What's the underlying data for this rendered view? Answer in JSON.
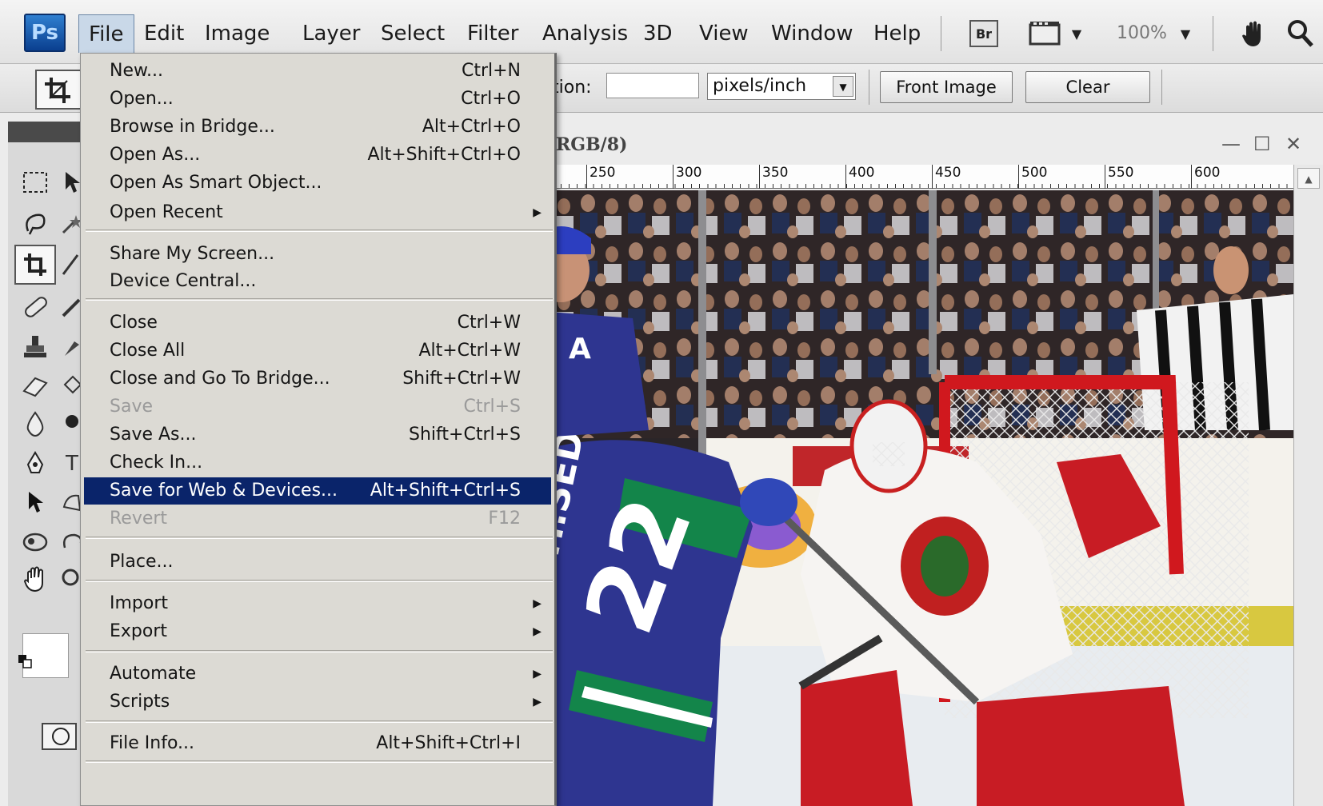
{
  "app": {
    "logo": "Ps"
  },
  "menubar": {
    "items": [
      "File",
      "Edit",
      "Image",
      "Layer",
      "Select",
      "Filter",
      "Analysis",
      "3D",
      "View",
      "Window",
      "Help"
    ],
    "bridge_label": "Br",
    "zoom": "100%"
  },
  "options": {
    "resolution_label": "tion:",
    "resolution_value": "",
    "units": "pixels/inch",
    "front_image": "Front Image",
    "clear": "Clear"
  },
  "document": {
    "title": "RGB/8)",
    "ruler": [
      "250",
      "300",
      "350",
      "400",
      "450",
      "500",
      "550",
      "600"
    ]
  },
  "file_menu": {
    "items": [
      {
        "label": "New...",
        "shortcut": "Ctrl+N"
      },
      {
        "label": "Open...",
        "shortcut": "Ctrl+O"
      },
      {
        "label": "Browse in Bridge...",
        "shortcut": "Alt+Ctrl+O"
      },
      {
        "label": "Open As...",
        "shortcut": "Alt+Shift+Ctrl+O"
      },
      {
        "label": "Open As Smart Object...",
        "shortcut": ""
      },
      {
        "label": "Open Recent",
        "shortcut": ""
      },
      {
        "label": "Share My Screen...",
        "shortcut": ""
      },
      {
        "label": "Device Central...",
        "shortcut": ""
      },
      {
        "label": "Close",
        "shortcut": "Ctrl+W"
      },
      {
        "label": "Close All",
        "shortcut": "Alt+Ctrl+W"
      },
      {
        "label": "Close and Go To Bridge...",
        "shortcut": "Shift+Ctrl+W"
      },
      {
        "label": "Save",
        "shortcut": "Ctrl+S"
      },
      {
        "label": "Save As...",
        "shortcut": "Shift+Ctrl+S"
      },
      {
        "label": "Check In...",
        "shortcut": ""
      },
      {
        "label": "Save for Web & Devices...",
        "shortcut": "Alt+Shift+Ctrl+S"
      },
      {
        "label": "Revert",
        "shortcut": "F12"
      },
      {
        "label": "Place...",
        "shortcut": ""
      },
      {
        "label": "Import",
        "shortcut": ""
      },
      {
        "label": "Export",
        "shortcut": ""
      },
      {
        "label": "Automate",
        "shortcut": ""
      },
      {
        "label": "Scripts",
        "shortcut": ""
      },
      {
        "label": "File Info...",
        "shortcut": "Alt+Shift+Ctrl+I"
      }
    ]
  },
  "colors": {
    "highlight": "#0a246a",
    "menu_bg": "#dcdad4",
    "background_swatch": "#52f3f7",
    "foreground_swatch": "#ffffff"
  },
  "photo": {
    "jersey_name": "H.SEDIN",
    "jersey_number": "22",
    "captain_letter": "A"
  }
}
